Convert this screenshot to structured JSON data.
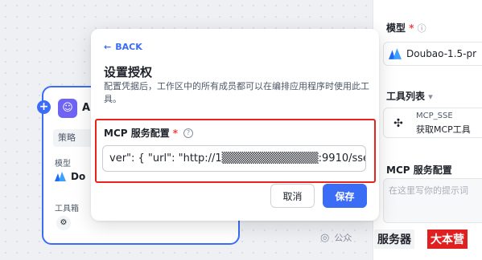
{
  "colors": {
    "accent": "#3b6cf6",
    "highlight_border": "#e8231a",
    "required_star": "#f53f3f",
    "watermark_red": "#e02020"
  },
  "node": {
    "name": "A",
    "tab": "策略",
    "model_label": "模型",
    "model_value": "Do",
    "tools_label": "工具箱",
    "icon": "robot-icon"
  },
  "right_panel": {
    "model_label": "模型",
    "model_value": "Doubao-1.5-pr",
    "tools_label": "工具列表",
    "tool_name": "MCP_SSE",
    "tool_desc": "获取MCP工具",
    "mcp_label": "MCP 服务配置",
    "mcp_placeholder": "在这里写你的提示词"
  },
  "modal": {
    "back_label": "BACK",
    "title": "设置授权",
    "description": "配置凭据后，工作区中的所有成员都可以在编排应用程序时使用此工具。",
    "field_label": "MCP 服务配置",
    "field_required": "*",
    "field_value": "ver\": {    \"url\": \"http://1▒▒▒▒▒▒▒▒▒▒▒▒:9910/sse\",",
    "cancel_label": "取消",
    "save_label": "保存"
  },
  "watermark": {
    "platform": "公众",
    "badge_left": "服务器",
    "badge_right": "大本营"
  }
}
